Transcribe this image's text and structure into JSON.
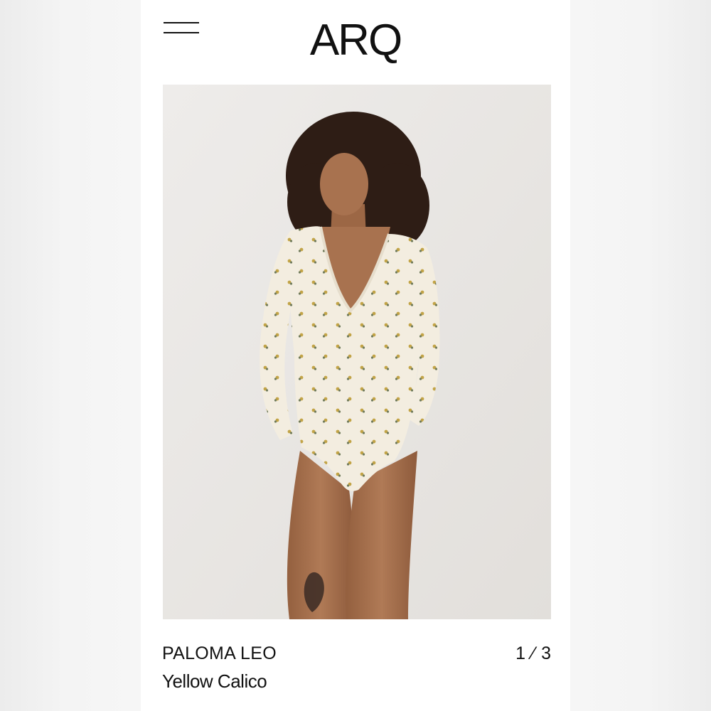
{
  "brand": {
    "logo_text": "ARQ"
  },
  "header": {
    "menu_icon": "hamburger-menu-icon"
  },
  "hero": {
    "image_subject": "product-photo"
  },
  "product": {
    "name": "PALOMA LEO",
    "color": "Yellow Calico"
  },
  "gallery": {
    "current": 1,
    "total": 3,
    "pager_text": "1 ⁄ 3"
  },
  "colors": {
    "text": "#111111",
    "background": "#ffffff",
    "photo_backdrop": "#e8e6e3",
    "garment": "#f3ede0",
    "print_accent": "#b99c3d",
    "skin": "#a6704e",
    "hair": "#2e1d15"
  }
}
